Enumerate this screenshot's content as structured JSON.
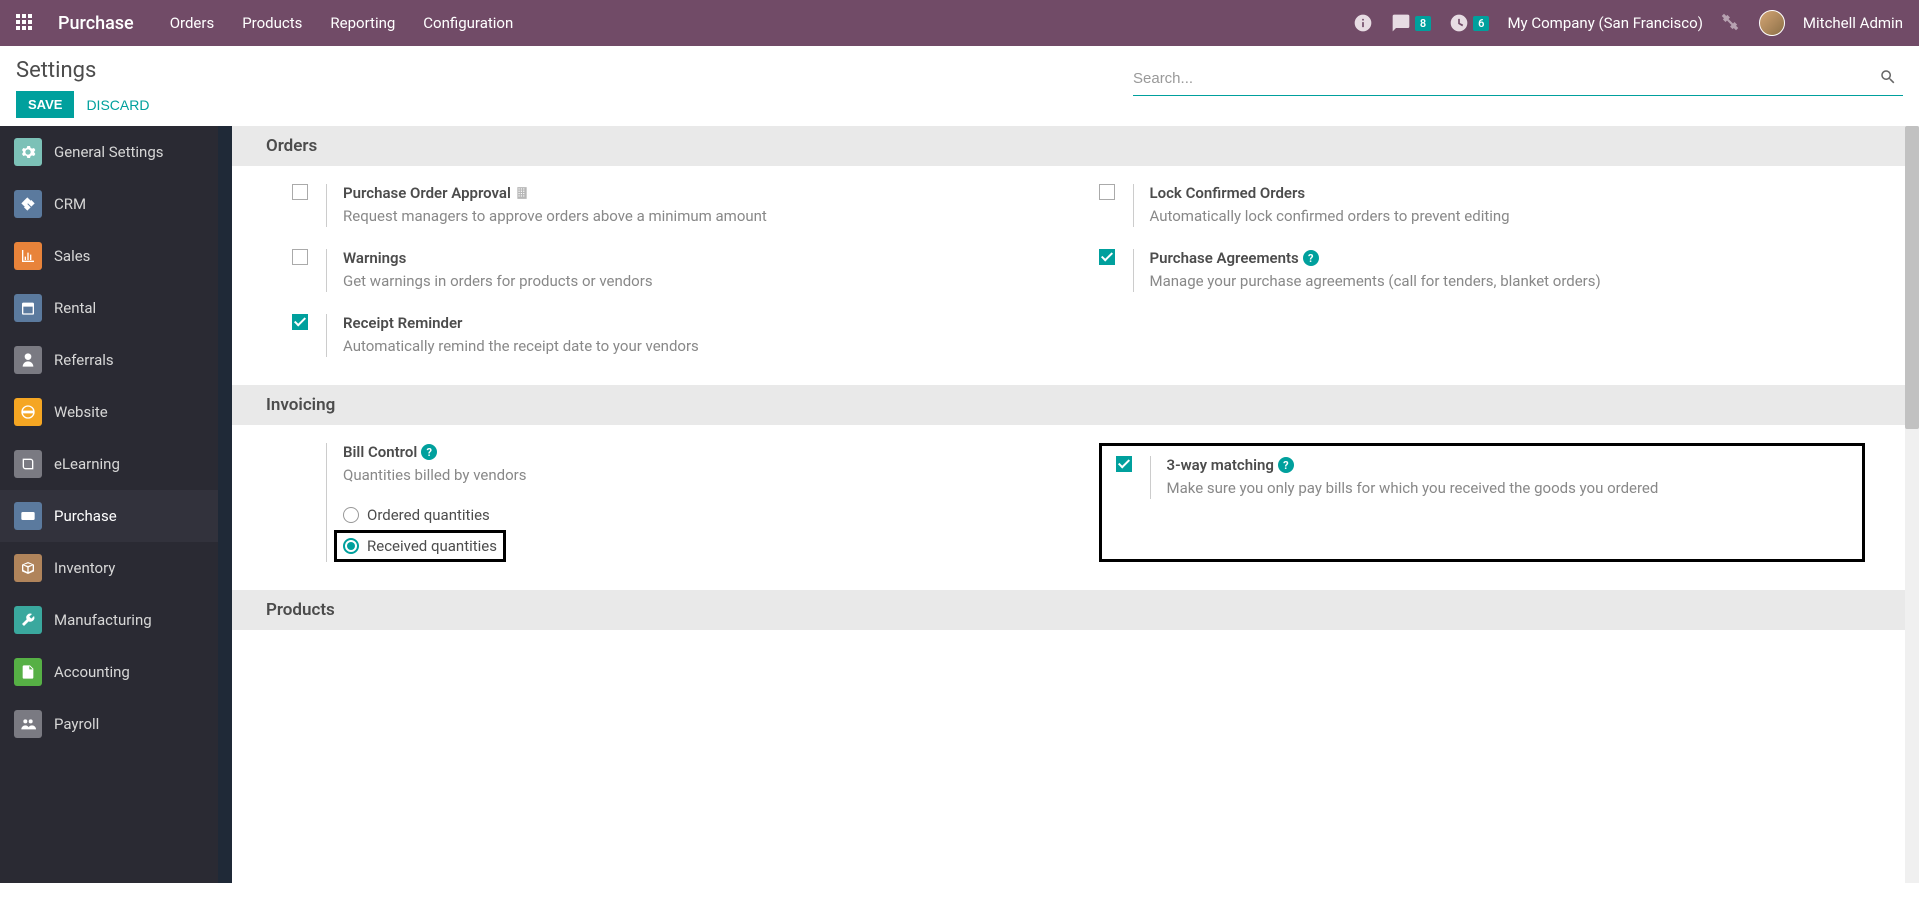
{
  "navbar": {
    "brand": "Purchase",
    "menu": [
      "Orders",
      "Products",
      "Reporting",
      "Configuration"
    ],
    "messages_badge": "8",
    "activities_badge": "6",
    "company": "My Company (San Francisco)",
    "user": "Mitchell Admin"
  },
  "control_panel": {
    "title": "Settings",
    "save": "SAVE",
    "discard": "DISCARD",
    "search_placeholder": "Search..."
  },
  "sidebar": {
    "items": [
      {
        "label": "General Settings",
        "icon": "gear",
        "color": "icon-color-teal"
      },
      {
        "label": "CRM",
        "icon": "handshake",
        "color": "icon-color-blue"
      },
      {
        "label": "Sales",
        "icon": "chart",
        "color": "icon-color-orange2"
      },
      {
        "label": "Rental",
        "icon": "calendar",
        "color": "icon-color-blue"
      },
      {
        "label": "Referrals",
        "icon": "person",
        "color": "icon-color-gray"
      },
      {
        "label": "Website",
        "icon": "globe",
        "color": "icon-color-orange"
      },
      {
        "label": "eLearning",
        "icon": "book",
        "color": "icon-color-gray"
      },
      {
        "label": "Purchase",
        "icon": "card",
        "color": "icon-color-blue",
        "active": true
      },
      {
        "label": "Inventory",
        "icon": "box",
        "color": "icon-color-brown"
      },
      {
        "label": "Manufacturing",
        "icon": "wrench",
        "color": "icon-color-teal2"
      },
      {
        "label": "Accounting",
        "icon": "doc",
        "color": "icon-color-green"
      },
      {
        "label": "Payroll",
        "icon": "people",
        "color": "icon-color-gray"
      }
    ]
  },
  "sections": {
    "orders": {
      "title": "Orders",
      "items": {
        "po_approval": {
          "title": "Purchase Order Approval",
          "desc": "Request managers to approve orders above a minimum amount",
          "checked": false
        },
        "lock_confirmed": {
          "title": "Lock Confirmed Orders",
          "desc": "Automatically lock confirmed orders to prevent editing",
          "checked": false
        },
        "warnings": {
          "title": "Warnings",
          "desc": "Get warnings in orders for products or vendors",
          "checked": false
        },
        "agreements": {
          "title": "Purchase Agreements",
          "desc": "Manage your purchase agreements (call for tenders, blanket orders)",
          "checked": true,
          "help": true
        },
        "receipt_reminder": {
          "title": "Receipt Reminder",
          "desc": "Automatically remind the receipt date to your vendors",
          "checked": true
        }
      }
    },
    "invoicing": {
      "title": "Invoicing",
      "bill_control": {
        "title": "Bill Control",
        "desc": "Quantities billed by vendors",
        "help": true,
        "radios": {
          "ordered": "Ordered quantities",
          "received": "Received quantities"
        },
        "selected": "received"
      },
      "three_way": {
        "title": "3-way matching",
        "desc": "Make sure you only pay bills for which you received the goods you ordered",
        "checked": true,
        "help": true
      }
    },
    "products": {
      "title": "Products"
    }
  }
}
